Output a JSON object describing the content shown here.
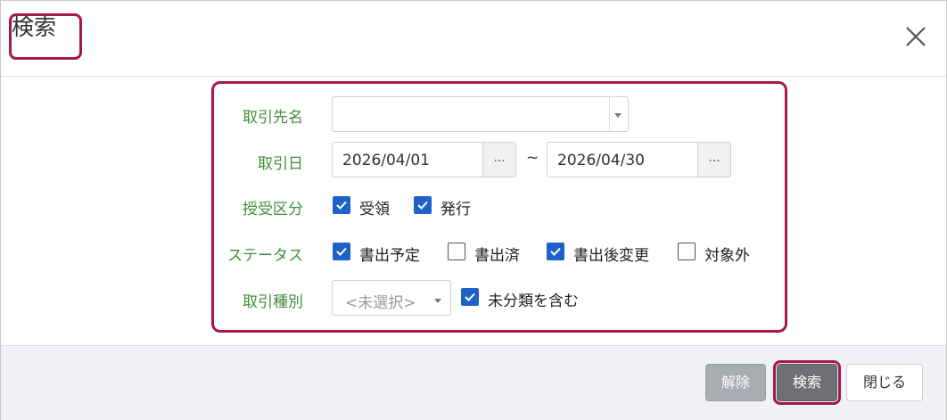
{
  "dialog": {
    "title": "検索",
    "close_icon": "close-icon"
  },
  "form": {
    "partner": {
      "label": "取引先名",
      "value": ""
    },
    "trade_date": {
      "label": "取引日",
      "from": "2026/04/01",
      "to": "2026/04/30",
      "tilde": "~",
      "picker_label": "..."
    },
    "direction": {
      "label": "授受区分",
      "options": [
        {
          "label": "受領",
          "checked": true
        },
        {
          "label": "発行",
          "checked": true
        }
      ]
    },
    "status": {
      "label": "ステータス",
      "options": [
        {
          "label": "書出予定",
          "checked": true
        },
        {
          "label": "書出済",
          "checked": false
        },
        {
          "label": "書出後変更",
          "checked": true
        },
        {
          "label": "対象外",
          "checked": false
        }
      ]
    },
    "trade_type": {
      "label": "取引種別",
      "placeholder": "<未選択>",
      "include_unclassified": {
        "label": "未分類を含む",
        "checked": true
      }
    }
  },
  "footer": {
    "clear_label": "解除",
    "search_label": "検索",
    "close_label": "閉じる"
  },
  "colors": {
    "accent_outline": "#a8174a",
    "label_green": "#3f8e3a",
    "checkbox_blue": "#1e62c9"
  }
}
